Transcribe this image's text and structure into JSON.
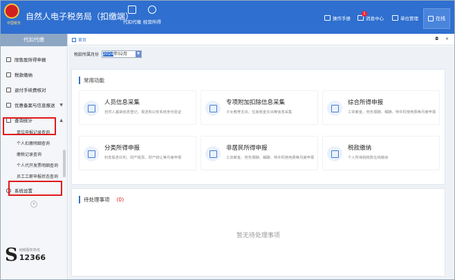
{
  "header": {
    "logo_text": "中国税务",
    "title": "自然人电子税务局（扣缴端）",
    "buttons": [
      {
        "label": "代扣代缴",
        "icon": "withholding-icon"
      },
      {
        "label": "经营所得",
        "icon": "business-income-icon"
      }
    ],
    "links": [
      {
        "label": "操作手册",
        "icon": "manual-icon"
      },
      {
        "label": "消息中心",
        "icon": "message-icon",
        "badge": "1"
      },
      {
        "label": "单位管理",
        "icon": "unit-icon"
      }
    ],
    "online_label": "在线"
  },
  "sidebar": {
    "header": "代扣代缴",
    "items": [
      {
        "label": "限售股所得申报",
        "icon": "chart-icon"
      },
      {
        "label": "税款缴纳",
        "icon": "tax-icon"
      },
      {
        "label": "退付手续费核对",
        "icon": "refund-icon"
      },
      {
        "label": "优惠备案与信息报送",
        "icon": "record-icon",
        "caret": "▼"
      },
      {
        "label": "查询统计",
        "icon": "stats-icon",
        "caret": "▲"
      }
    ],
    "sub_items": [
      "单位申报记录查询",
      "个人扣缴明细查询",
      "缴税记录查询",
      "个人代开发票明细查询",
      "员工工薪申报状态查询"
    ],
    "settings_label": "系统设置",
    "collapse_label": "«",
    "hotline_label": "纳税服务热线",
    "hotline_number": "12366"
  },
  "tabs": {
    "home": "首页",
    "controls": "◘ ×"
  },
  "filter": {
    "label": "税款所属月份",
    "value_selected": "2024",
    "value_rest": "年02月",
    "dropdown": "▼"
  },
  "common": {
    "title": "常用功能",
    "cards": [
      {
        "title": "人员信息采集",
        "desc": "自然人基础信息登记、报送和公安系统身份验证",
        "icon": "person-info-icon"
      },
      {
        "title": "专项附加扣除信息采集",
        "desc": "子女教育支出、住房租金支出等信息采集",
        "icon": "deduction-icon"
      },
      {
        "title": "综合所得申报",
        "desc": "工资薪金、劳务报酬、稿酬、特许权使用费等月度申报",
        "icon": "comprehensive-icon"
      },
      {
        "title": "分类所得申报",
        "desc": "利息股息红利、财产租赁、财产转让等月度申报",
        "icon": "category-icon"
      },
      {
        "title": "非居民所得申报",
        "desc": "工资薪金、劳务报酬、稿酬、特许权使用费等月度申报",
        "icon": "nonresident-icon"
      },
      {
        "title": "税款缴纳",
        "desc": "个人所得税税款在线缴纳",
        "icon": "payment-icon"
      }
    ]
  },
  "pending": {
    "title": "待处理事项",
    "count": "(0)",
    "empty": "暂无待处理事项"
  },
  "colors": {
    "brand": "#2f6fcf",
    "highlight": "#e01818"
  }
}
